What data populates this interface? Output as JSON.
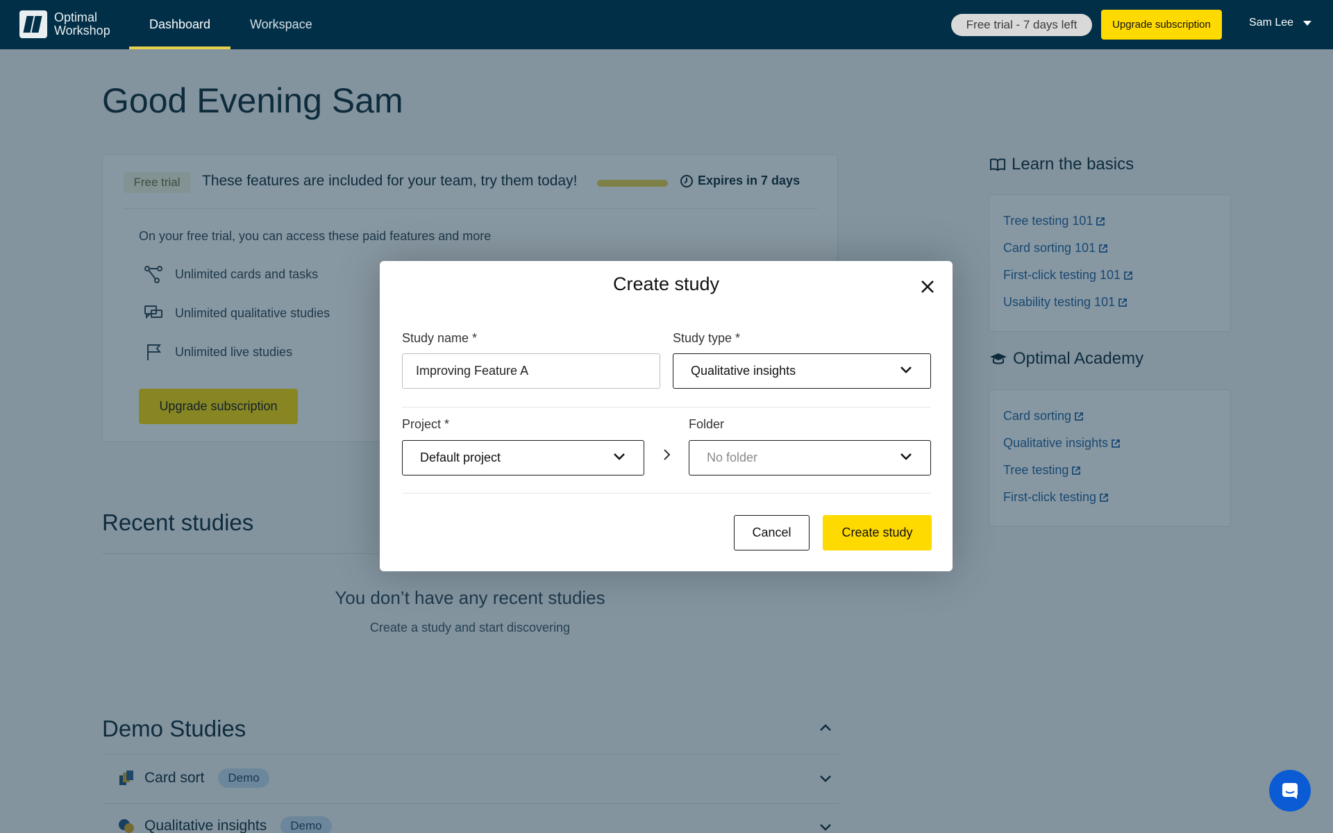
{
  "app": {
    "logo_line1": "Optimal",
    "logo_line2": "Workshop"
  },
  "nav": {
    "tabs": [
      {
        "label": "Dashboard",
        "active": true
      },
      {
        "label": "Workspace",
        "active": false
      }
    ],
    "trial_pill": "Free trial - 7 days left",
    "upgrade_label": "Upgrade subscription",
    "user_name": "Sam Lee"
  },
  "greeting": "Good Evening Sam",
  "trial_card": {
    "badge": "Free trial",
    "headline": "These features are included for your team, try them today!",
    "progress": 1.0,
    "expires": "Expires in 7 days",
    "intro": "On your free trial, you can access these paid features and more",
    "features": [
      {
        "label": "Unlimited cards and tasks",
        "icon": "flow-icon"
      },
      {
        "label": "Unlimited qualitative studies",
        "icon": "chat-bubbles-icon"
      },
      {
        "label": "Unlimited live studies",
        "icon": "flag-icon"
      }
    ],
    "upgrade_label": "Upgrade subscription"
  },
  "recent": {
    "title": "Recent studies",
    "empty_title": "You don’t have any recent studies",
    "empty_sub": "Create a study and start discovering"
  },
  "demo": {
    "title": "Demo Studies",
    "rows": [
      {
        "label": "Card sort",
        "badge": "Demo",
        "icon": "card-sort-icon"
      },
      {
        "label": "Qualitative insights",
        "badge": "Demo",
        "icon": "qualitative-icon"
      }
    ]
  },
  "learn": {
    "title": "Learn the basics",
    "links": [
      "Tree testing 101",
      "Card sorting 101",
      "First-click testing 101",
      "Usability testing 101"
    ]
  },
  "academy": {
    "title": "Optimal Academy",
    "links": [
      "Card sorting",
      "Qualitative insights",
      "Tree testing",
      "First-click testing"
    ]
  },
  "modal": {
    "title": "Create study",
    "study_name_label": "Study name *",
    "study_name_value": "Improving Feature A",
    "study_type_label": "Study type *",
    "study_type_value": "Qualitative insights",
    "project_label": "Project *",
    "project_value": "Default project",
    "folder_label": "Folder",
    "folder_value": "No folder",
    "cancel_label": "Cancel",
    "create_label": "Create study"
  },
  "colors": {
    "nav_bg": "#012f47",
    "accent_yellow": "#ffda00",
    "link_blue": "#1f5f9f",
    "chat_blue": "#0b5cd4"
  }
}
